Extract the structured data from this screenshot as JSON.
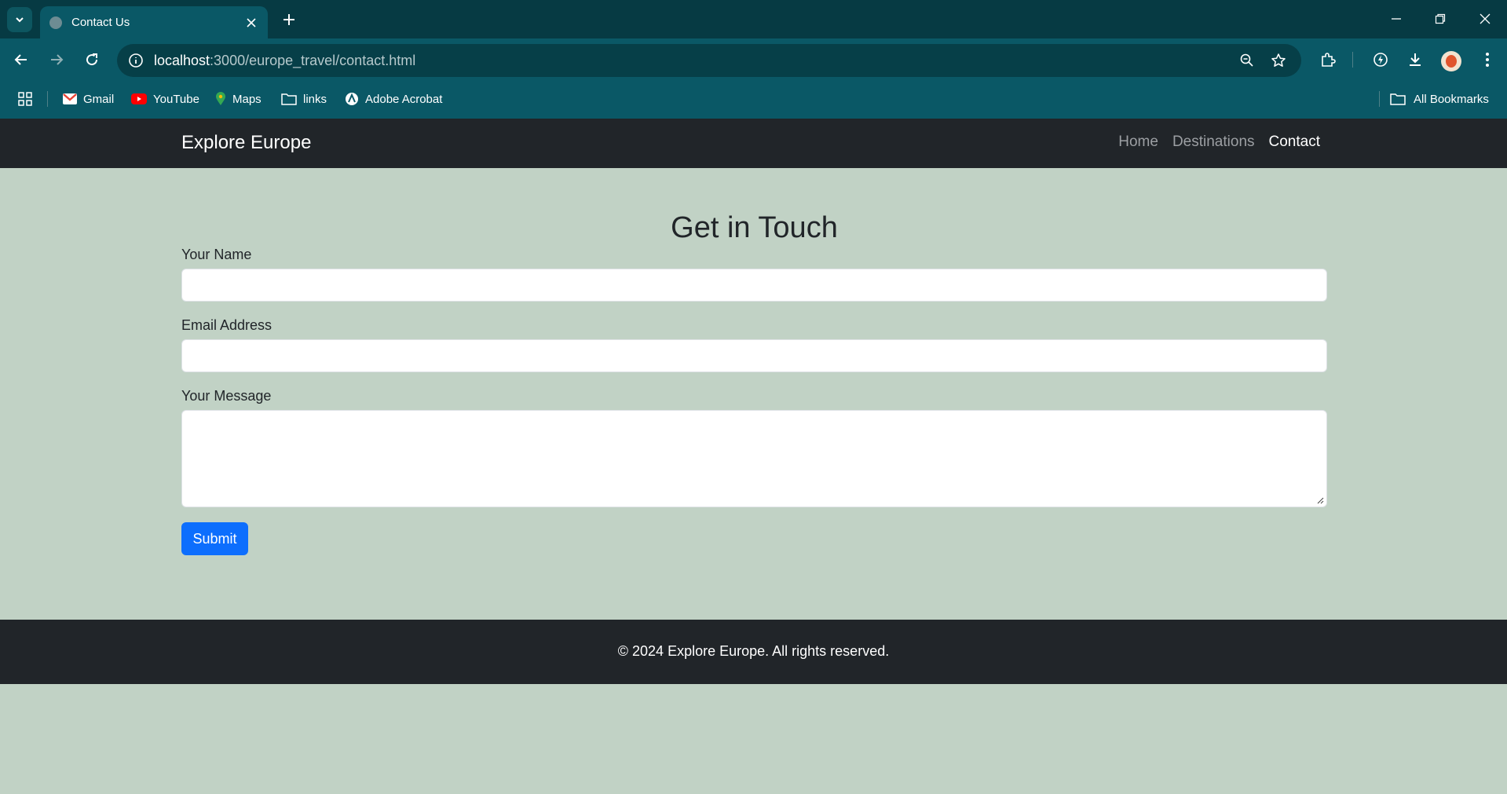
{
  "browser": {
    "tab": {
      "title": "Contact Us"
    },
    "address_bar": {
      "host": "localhost",
      "path": ":3000/europe_travel/contact.html"
    },
    "bookmarks": [
      {
        "label": "Gmail",
        "icon": "gmail-icon"
      },
      {
        "label": "YouTube",
        "icon": "youtube-icon"
      },
      {
        "label": "Maps",
        "icon": "maps-icon"
      },
      {
        "label": "links",
        "icon": "folder-icon"
      },
      {
        "label": "Adobe Acrobat",
        "icon": "acrobat-icon"
      }
    ],
    "all_bookmarks_label": "All Bookmarks"
  },
  "site": {
    "brand": "Explore Europe",
    "nav": [
      {
        "label": "Home",
        "active": false
      },
      {
        "label": "Destinations",
        "active": false
      },
      {
        "label": "Contact",
        "active": true
      }
    ]
  },
  "contact_form": {
    "heading": "Get in Touch",
    "name_label": "Your Name",
    "name_value": "",
    "email_label": "Email Address",
    "email_value": "",
    "message_label": "Your Message",
    "message_value": "",
    "submit_label": "Submit"
  },
  "footer": {
    "text": "© 2024 Explore Europe. All rights reserved."
  },
  "colors": {
    "page_background": "#c1d2c5",
    "navbar": "#212529",
    "primary_button": "#0d6efd",
    "browser_frame": "#063a43",
    "browser_toolbar": "#0a5866"
  }
}
